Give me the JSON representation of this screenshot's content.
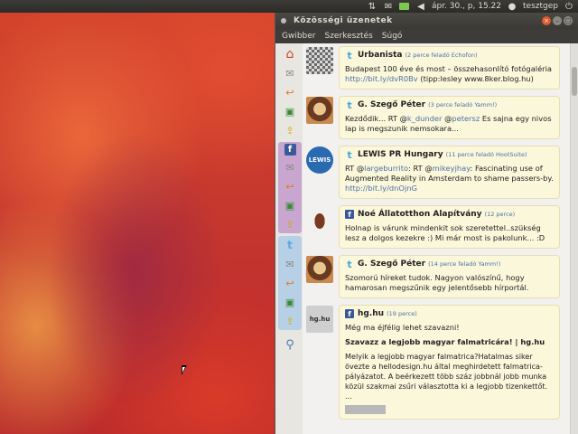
{
  "top_panel": {
    "network_icon": "network-arrows-icon",
    "mail_icon": "mail-icon",
    "volume_icon": "volume-icon",
    "clock": "ápr. 30., p, 15.22",
    "user": "tesztgep",
    "user_icon": "user-icon",
    "power_icon": "power-icon"
  },
  "window": {
    "title": "Közösségi üzenetek",
    "menu": [
      "Gwibber",
      "Szerkesztés",
      "Súgó"
    ]
  },
  "messages": [
    {
      "service": "twitter",
      "author": "Urbanista",
      "meta": "(2 perce feladó Echofon)",
      "text": "Budapest 100 éve és most – összehasonlító fotógaléria ",
      "link": "http://bit.ly/dvR0Bv",
      "text_after": " (tipp:lesley www.8ker.blog.hu)"
    },
    {
      "service": "twitter",
      "author": "G. Szegő Péter",
      "meta": "(3 perce feladó Yamm!)",
      "text_before": "Kezdődik... RT @",
      "mention1": "k_dunder",
      "text_mid": " @",
      "mention2": "petersz",
      "text_after": " Es sajna egy nivos lap is megszunik nemsokara..."
    },
    {
      "service": "twitter",
      "author": "LEWIS PR Hungary",
      "meta": "(11 perce feladó HootSuite)",
      "text_before": "RT @",
      "mention1": "largeburrito",
      "text_mid": ": RT @",
      "mention2": "mikeyjhay",
      "text_after": ": Fascinating use of Augmented Reality in Amsterdam to shame passers-by. ",
      "link": "http://bit.ly/dnOjnG"
    },
    {
      "service": "facebook",
      "author": "Noé Állatotthon Alapítvány",
      "meta": "(12 perce)",
      "text": "Holnap is várunk mindenkit sok szeretettel..szükség lesz a dolgos kezekre :) Mi már most is pakolunk... :D"
    },
    {
      "service": "twitter",
      "author": "G. Szegő Péter",
      "meta": "(14 perce feladó Yamm!)",
      "text": "Szomorú híreket tudok. Nagyon valószínű, hogy hamarosan megszűnik egy jelentősebb hírportál."
    },
    {
      "service": "facebook",
      "author": "hg.hu",
      "meta": "(19 perce)",
      "text": "Még ma éjfélig lehet szavazni!",
      "attachment_title": "Szavazz a legjobb magyar falmatricára! | hg.hu",
      "attachment_body": "Melyik a legjobb magyar falmatrica?Hatalmas siker övezte a hellodesign.hu által meghirdetett falmatrica-pályázatot. A beérkezett több száz jobbnál jobb munka közül szakmai zsűri választotta ki a legjobb tizenkettőt. ..."
    }
  ],
  "avatars": {
    "lewis": "LEWIS",
    "hg": "hg.hu"
  }
}
